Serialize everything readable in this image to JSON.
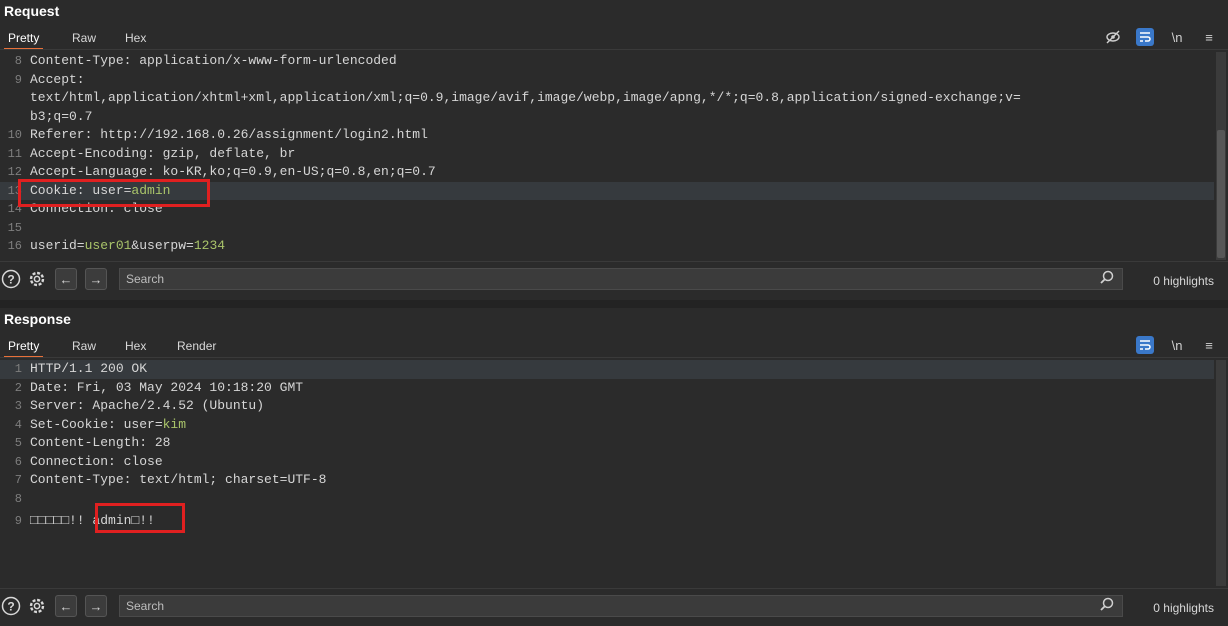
{
  "request": {
    "title": "Request",
    "tabs": [
      "Pretty",
      "Raw",
      "Hex"
    ],
    "lines": [
      {
        "n": "8",
        "text": "Content-Type: application/x-www-form-urlencoded"
      },
      {
        "n": "9",
        "text": "Accept:"
      },
      {
        "n": "",
        "text": "text/html,application/xhtml+xml,application/xml;q=0.9,image/avif,image/webp,image/apng,*/*;q=0.8,application/signed-exchange;v="
      },
      {
        "n": "",
        "text": "b3;q=0.7"
      },
      {
        "n": "10",
        "text": "Referer: http://192.168.0.26/assignment/login2.html"
      },
      {
        "n": "11",
        "text": "Accept-Encoding: gzip, deflate, br"
      },
      {
        "n": "12",
        "text": "Accept-Language: ko-KR,ko;q=0.9,en-US;q=0.8,en;q=0.7"
      },
      {
        "n": "13",
        "key": "Cookie: user=",
        "value": "admin"
      },
      {
        "n": "14",
        "text": "Connection: close"
      },
      {
        "n": "15",
        "text": ""
      },
      {
        "n": "16",
        "key": "userid=",
        "value": "user01",
        "key2": "&userpw=",
        "value2": "1234"
      }
    ],
    "search_placeholder": "Search",
    "highlights": "0 highlights"
  },
  "response": {
    "title": "Response",
    "tabs": [
      "Pretty",
      "Raw",
      "Hex",
      "Render"
    ],
    "lines": [
      {
        "n": "1",
        "text": "HTTP/1.1 200 OK"
      },
      {
        "n": "2",
        "text": "Date: Fri, 03 May 2024 10:18:20 GMT"
      },
      {
        "n": "3",
        "text": "Server: Apache/2.4.52 (Ubuntu)"
      },
      {
        "n": "4",
        "key": "Set-Cookie: user=",
        "value": "kim"
      },
      {
        "n": "5",
        "text": "Content-Length: 28"
      },
      {
        "n": "6",
        "text": "Connection: close"
      },
      {
        "n": "7",
        "text": "Content-Type: text/html; charset=UTF-8"
      },
      {
        "n": "8",
        "text": ""
      },
      {
        "n": "9",
        "text": "□□□□□!! admin□!!"
      }
    ],
    "search_placeholder": "Search",
    "highlights": "0 highlights"
  },
  "icons": {
    "hide": "eye-slash-icon",
    "wrap": "wrap-lines-icon",
    "newline": "\\n",
    "menu": "hamburger-menu-icon",
    "help": "?",
    "settings": "gear-icon",
    "back": "←",
    "forward": "→",
    "search": "magnifier-icon"
  },
  "colors": {
    "accent_tab": "#e8713a",
    "value_green": "#a9c46a",
    "annotation_red": "#e02020",
    "wrap_blue": "#3a78c9"
  }
}
